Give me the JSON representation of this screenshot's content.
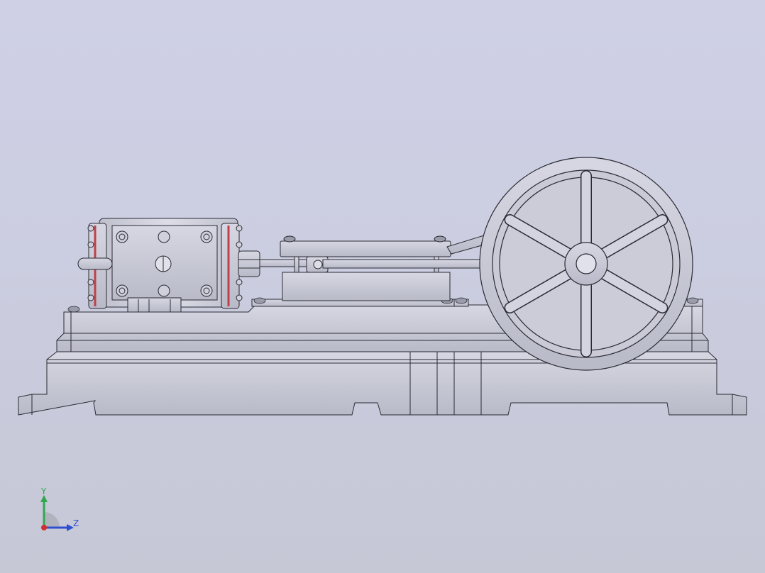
{
  "viewport": {
    "background_top": "#cfd0e6",
    "background_bottom": "#c6c8d6"
  },
  "model": {
    "part_color": "#c9cad6",
    "edge_color": "#2a2a32",
    "gasket_color": "#c0404a",
    "components": [
      "base-frame",
      "cylinder",
      "piston-rod",
      "crosshead-guide",
      "connecting-rod",
      "flywheel",
      "crank-bearing"
    ],
    "flywheel_spokes": 6
  },
  "triad": {
    "y_label": "Y",
    "z_label": "Z",
    "y_color": "#2fa84f",
    "z_color": "#2f4fd0",
    "x_color": "#d03030"
  }
}
